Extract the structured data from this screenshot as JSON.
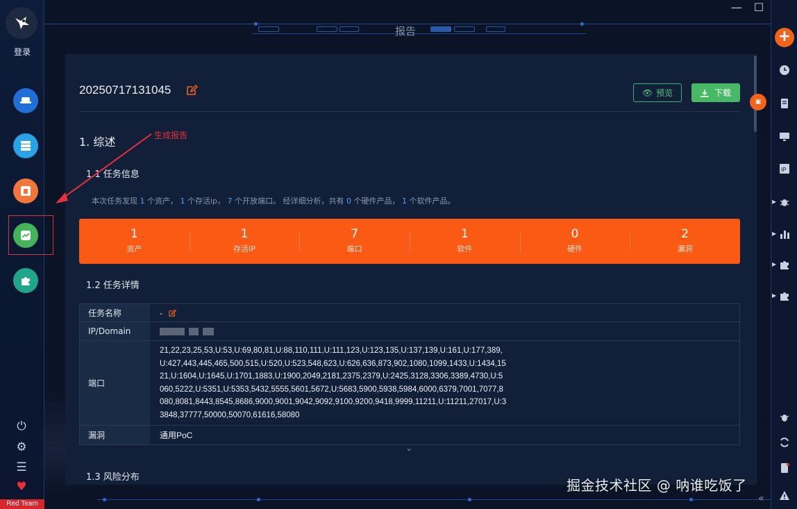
{
  "sidebar": {
    "login_label": "登录",
    "nav_items": [
      {
        "name": "assets-nav",
        "color": "#1f6fd6",
        "icon": "hat-icon"
      },
      {
        "name": "servers-nav",
        "color": "#27a3e6",
        "icon": "server-icon"
      },
      {
        "name": "vulns-nav",
        "color": "#f0763a",
        "icon": "bug-box-icon"
      },
      {
        "name": "report-nav",
        "color": "#44b35a",
        "icon": "chart-icon"
      },
      {
        "name": "plugins-nav",
        "color": "#1fa58a",
        "icon": "puzzle-icon"
      }
    ],
    "badge": "Red Team"
  },
  "topbar": {
    "title": "报告"
  },
  "report": {
    "id": "20250717131045",
    "preview_label": "预览",
    "download_label": "下载",
    "section1": "1. 综述",
    "section1_1": "1.1 任务信息",
    "summary": {
      "p1": "本次任务发现",
      "assets": "1",
      "p2": "个资产，",
      "alive": "1",
      "p3": "个存活ip，",
      "ports": "7",
      "p4": "个开放端口。 经详细分析，共有",
      "hardware": "0",
      "p5": "个硬件产品，",
      "software": "1",
      "p6": "个软件产品。"
    },
    "stats": [
      {
        "value": "1",
        "label": "资产"
      },
      {
        "value": "1",
        "label": "存活IP"
      },
      {
        "value": "7",
        "label": "端口"
      },
      {
        "value": "1",
        "label": "软件"
      },
      {
        "value": "0",
        "label": "硬件"
      },
      {
        "value": "2",
        "label": "漏洞"
      }
    ],
    "section1_2": "1.2 任务详情",
    "details": {
      "name_key": "任务名称",
      "name_val": "-",
      "ip_key": "IP/Domain",
      "port_key": "端口",
      "port_val": "21,22,23,25,53,U:53,U:69,80,81,U:88,110,111,U:111,123,U:123,135,U:137,139,U:161,U:177,389,U:427,443,445,465,500,515,U:520,U:523,548,623,U:626,636,873,902,1080,1099,1433,U:1434,1521,U:1604,U:1645,U:1701,1883,U:1900,2049,2181,2375,2379,U:2425,3128,3306,3389,4730,U:5060,5222,U:5351,U:5353,5432,5555,5601,5672,U:5683,5900,5938,5984,6000,6379,7001,7077,8080,8081,8443,8545,8686,9000,9001,9042,9092,9100,9200,9418,9999,11211,U:11211,27017,U:33848,37777,50000,50070,61616,58080",
      "vuln_key": "漏洞",
      "vuln_val": "通用PoC"
    },
    "section1_3": "1.3 风险分布"
  },
  "annotation": {
    "label": "生成报告",
    "color": "#e8303a"
  },
  "watermark": "掘金技术社区 @ 呐谁吃饭了",
  "accent": "#fa5a14"
}
